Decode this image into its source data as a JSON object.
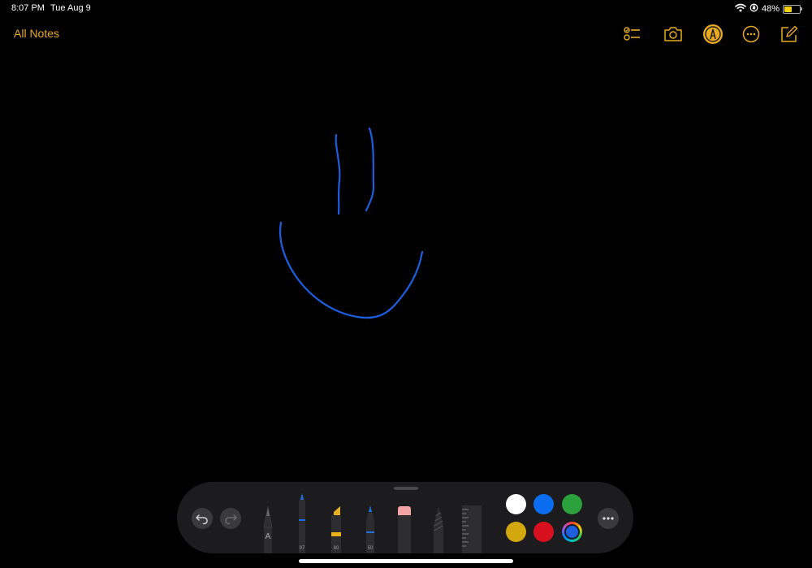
{
  "status_bar": {
    "time": "8:07 PM",
    "date": "Tue Aug 9",
    "battery_percent": "48%",
    "battery_level": 0.48,
    "icons": [
      "wifi-icon",
      "orientation-lock-icon",
      "battery-icon"
    ]
  },
  "nav": {
    "back_label": "All Notes",
    "icons": [
      "checklist-icon",
      "camera-icon",
      "markup-pen-icon",
      "more-icon",
      "compose-icon"
    ],
    "accent": "#e9a920"
  },
  "canvas": {
    "stroke_color": "#1e5fe0",
    "description_shapes": [
      "stroke-1",
      "stroke-2",
      "stroke-3"
    ]
  },
  "tool_palette": {
    "buttons": [
      "undo-icon",
      "redo-icon",
      "more-options-icon"
    ],
    "tools": [
      {
        "name": "monoline-pen",
        "label": "A"
      },
      {
        "name": "pen",
        "label": "97",
        "tip_color": "#1e6ee6"
      },
      {
        "name": "highlighter",
        "label": "80",
        "tip_color": "#e8b21e"
      },
      {
        "name": "pencil",
        "label": "50",
        "tip_color": "#1e6ee6"
      },
      {
        "name": "eraser",
        "label": ""
      },
      {
        "name": "lasso",
        "label": ""
      },
      {
        "name": "ruler",
        "label": ""
      }
    ],
    "colors": [
      {
        "name": "white",
        "hex": "#ffffff"
      },
      {
        "name": "blue",
        "hex": "#0a6cf0"
      },
      {
        "name": "green",
        "hex": "#2aa13a"
      },
      {
        "name": "yellow",
        "hex": "#d3a80e"
      },
      {
        "name": "red",
        "hex": "#d8101e"
      },
      {
        "name": "custom",
        "hex": "#1e5fe0",
        "selected": true
      }
    ]
  }
}
